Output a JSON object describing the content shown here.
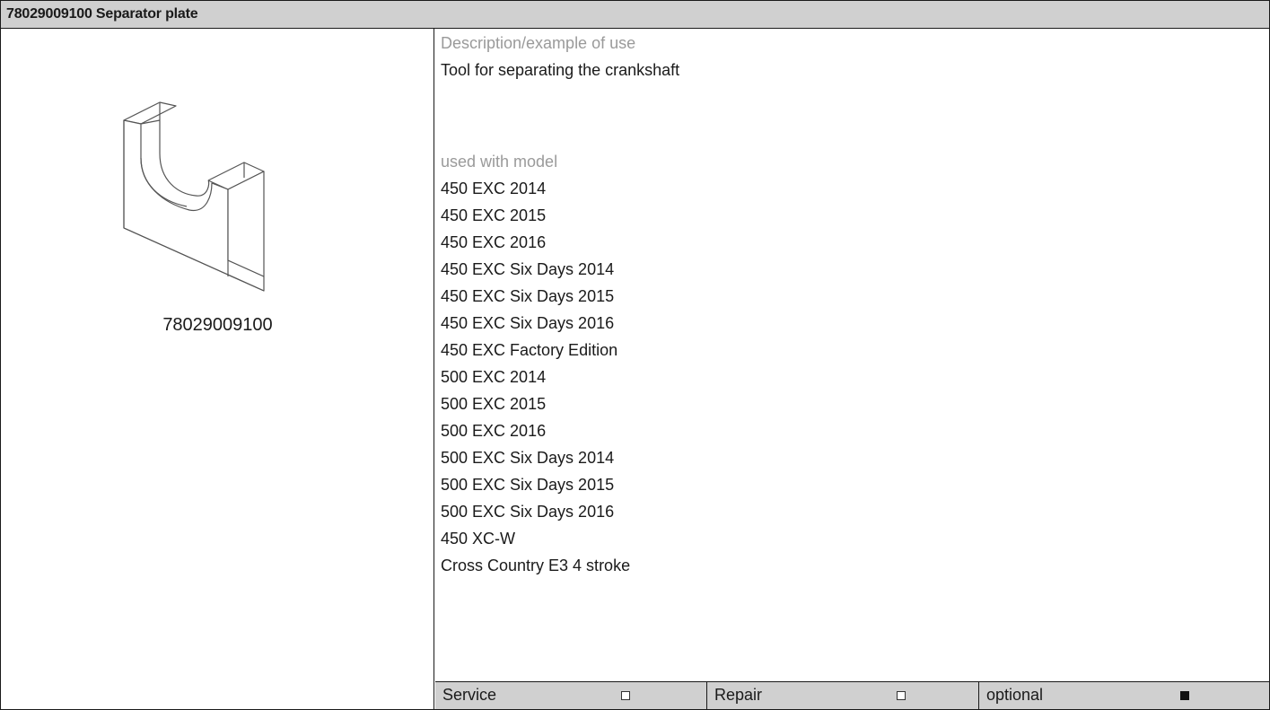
{
  "header": {
    "title": "78029009100 Separator plate"
  },
  "tool": {
    "part_number": "78029009100",
    "image_icon": "separator-plate-drawing"
  },
  "description": {
    "label": "Description/example of use",
    "text": "Tool for separating the crankshaft"
  },
  "models": {
    "label": "used with model",
    "items": [
      "450 EXC 2014",
      "450 EXC 2015",
      "450 EXC 2016",
      "450 EXC Six Days 2014",
      "450 EXC Six Days 2015",
      "450 EXC Six Days 2016",
      "450 EXC Factory Edition",
      "500 EXC 2014",
      "500 EXC 2015",
      "500 EXC 2016",
      "500 EXC Six Days 2014",
      "500 EXC Six Days 2015",
      "500 EXC Six Days 2016",
      "450 XC-W",
      "Cross Country E3 4 stroke"
    ]
  },
  "usage": {
    "service": {
      "label": "Service",
      "checked": false
    },
    "repair": {
      "label": "Repair",
      "checked": false
    },
    "optional": {
      "label": "optional",
      "checked": true
    }
  }
}
